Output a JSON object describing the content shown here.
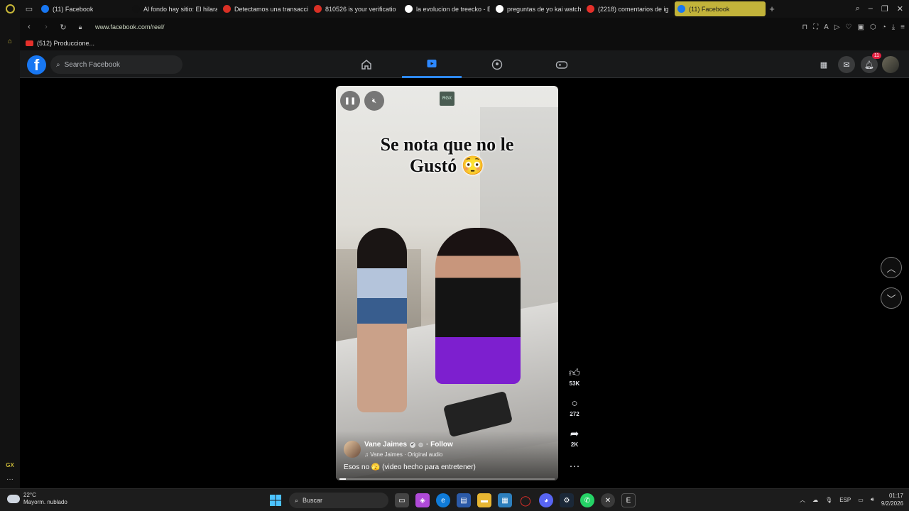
{
  "browser": {
    "tabs": [
      {
        "title": "(11) Facebook",
        "favicon": "facebook-icon",
        "color": "#1877f2"
      },
      {
        "title": "Al fondo hay sitio: El hilara",
        "favicon": "tiktok-icon",
        "color": "#111111"
      },
      {
        "title": "Detectamos una transacci",
        "favicon": "gmail-icon",
        "color": "#d93025"
      },
      {
        "title": "810526 is your verificatio",
        "favicon": "gmail-icon",
        "color": "#d93025"
      },
      {
        "title": "la evolucion de treecko - E",
        "favicon": "google-icon",
        "color": "#ffffff"
      },
      {
        "title": "preguntas de yo kai watch",
        "favicon": "google-icon",
        "color": "#ffffff"
      },
      {
        "title": "(2218) comentarios de ig",
        "favicon": "youtube-icon",
        "color": "#e5302a"
      },
      {
        "title": "(11) Facebook",
        "favicon": "facebook-icon",
        "color": "#1877f2",
        "active": true
      }
    ],
    "url": "www.facebook.com/reel/",
    "bookmark": "(512) Produccione...",
    "accent": "#c2b33a"
  },
  "sidebar": {
    "bottom_label": "GX",
    "more": "···"
  },
  "facebook": {
    "search_placeholder": "Search Facebook",
    "notifications_count": "11",
    "brand_color": "#1877f2"
  },
  "reel": {
    "caption_line1": "Se nota que no le",
    "caption_line2": "Gustó 😳",
    "watermark": "RGX",
    "author": "Vane Jaimes",
    "follow": "· Follow",
    "audio": "♫ Vane Jaimes · Original audio",
    "description": "Esos no 🫣 (video hecho para entretener)",
    "progress": 0.03
  },
  "actions": {
    "likes": "53K",
    "comments": "272",
    "shares": "2K",
    "more": "···"
  },
  "taskbar": {
    "temperature": "22°C",
    "weather": "Mayorm. nublado",
    "search": "Buscar",
    "language": "ESP",
    "time": "01:17",
    "date": "9/2/2026"
  }
}
